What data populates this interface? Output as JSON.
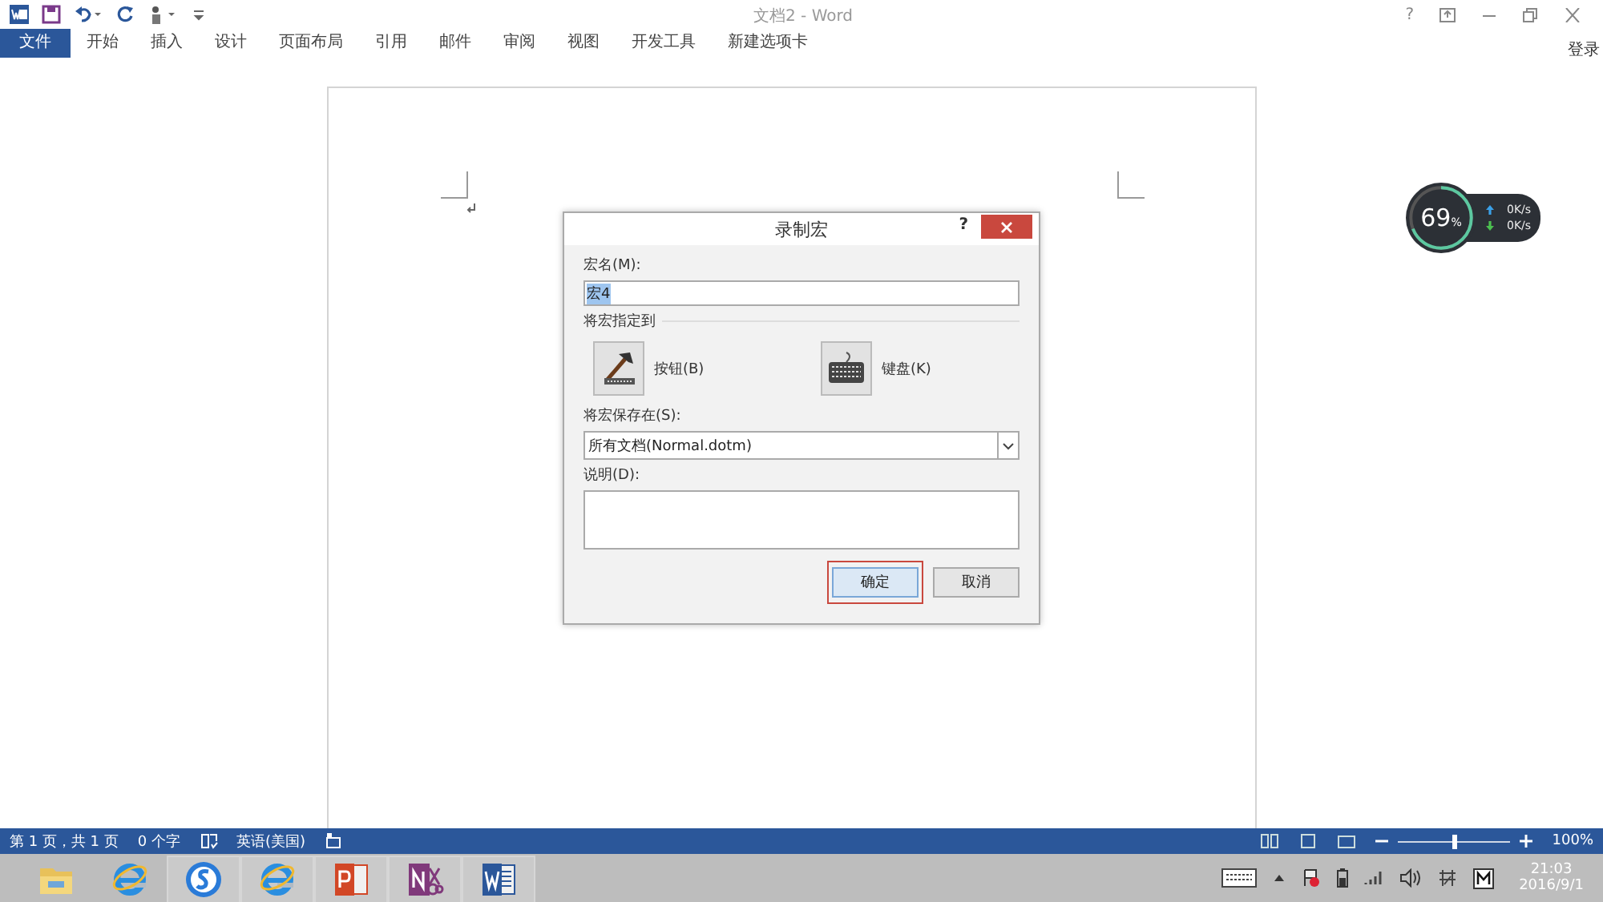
{
  "title_bar": {
    "title": "文档2 - Word",
    "help": "?",
    "signin": "登录"
  },
  "ribbon_tabs": [
    {
      "label": "文件",
      "selected": true
    },
    {
      "label": "开始",
      "selected": false
    },
    {
      "label": "插入",
      "selected": false
    },
    {
      "label": "设计",
      "selected": false
    },
    {
      "label": "页面布局",
      "selected": false
    },
    {
      "label": "引用",
      "selected": false
    },
    {
      "label": "邮件",
      "selected": false
    },
    {
      "label": "审阅",
      "selected": false
    },
    {
      "label": "视图",
      "selected": false
    },
    {
      "label": "开发工具",
      "selected": false
    },
    {
      "label": "新建选项卡",
      "selected": false
    }
  ],
  "dialog": {
    "title": "录制宏",
    "help": "?",
    "macro_name_label": "宏名(M):",
    "macro_name_value": "宏4",
    "assign_label": "将宏指定到",
    "assign_options": [
      {
        "kind": "button",
        "label": "按钮(B)"
      },
      {
        "kind": "keyboard",
        "label": "键盘(K)"
      }
    ],
    "store_label": "将宏保存在(S):",
    "store_value": "所有文档(Normal.dotm)",
    "description_label": "说明(D):",
    "ok": "确定",
    "cancel": "取消"
  },
  "net_widget": {
    "percent": "69",
    "unit": "%",
    "level": 0.69,
    "upload": "0K/s",
    "download": "0K/s"
  },
  "status_bar": {
    "page": "第 1 页，共 1 页",
    "words": "0 个字",
    "language": "英语(美国)",
    "zoom": "100%",
    "zoom_slider": {
      "level": 0.5
    }
  },
  "taskbar": {
    "apps": [
      {
        "kind": "folder",
        "running": false
      },
      {
        "kind": "ie",
        "running": false
      },
      {
        "kind": "sogou",
        "running": true
      },
      {
        "kind": "ie",
        "running": true
      },
      {
        "kind": "powerpoint",
        "running": true
      },
      {
        "kind": "onenote",
        "running": true
      },
      {
        "kind": "word",
        "running": true
      }
    ],
    "time": "21:03",
    "date": "2016/9/1"
  }
}
